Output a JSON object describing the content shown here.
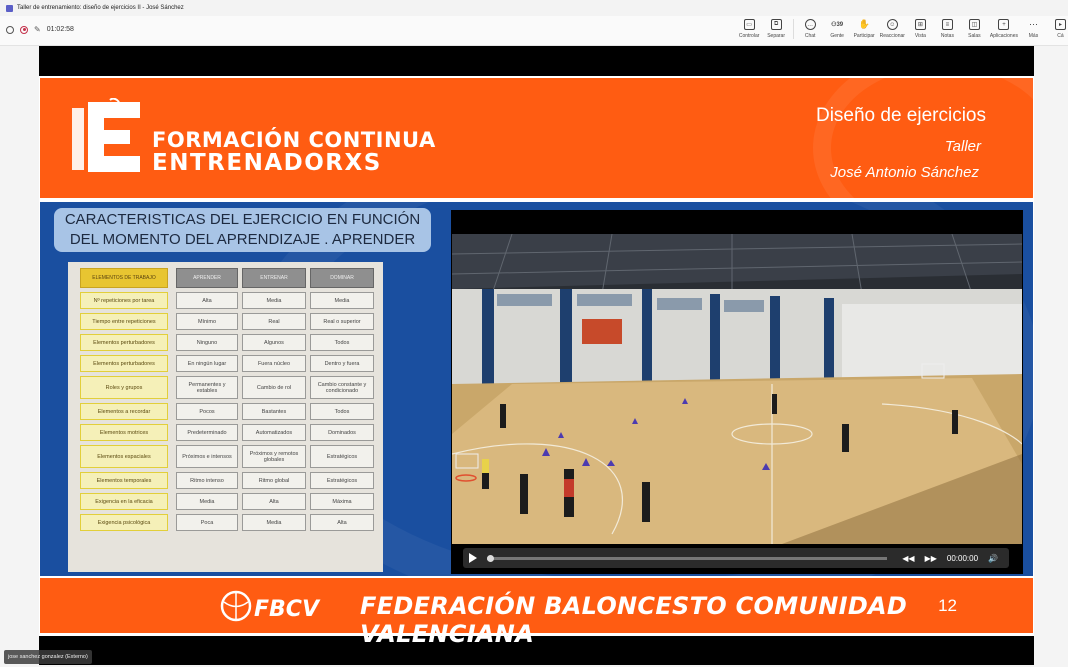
{
  "window": {
    "title": "Taller de entrenamiento: diseño de ejercicios II - José Sánchez"
  },
  "toolbar": {
    "timer": "01:02:58",
    "participants_count": "39",
    "tools": [
      {
        "label": "Controlar",
        "icon": "control-icon"
      },
      {
        "label": "Separar",
        "icon": "popout-icon"
      },
      {
        "label": "Chat",
        "icon": "chat-icon"
      },
      {
        "label": "Gente",
        "icon": "people-icon"
      },
      {
        "label": "Participar",
        "icon": "raise-hand-icon"
      },
      {
        "label": "Reaccionar",
        "icon": "smiley-icon"
      },
      {
        "label": "Vista",
        "icon": "grid-icon"
      },
      {
        "label": "Notas",
        "icon": "notes-icon"
      },
      {
        "label": "Salas",
        "icon": "rooms-icon"
      },
      {
        "label": "Aplicaciones",
        "icon": "add-icon"
      },
      {
        "label": "Más",
        "icon": "more-icon"
      },
      {
        "label": "Cá",
        "icon": "camera-icon"
      }
    ]
  },
  "slide": {
    "banner": {
      "logo_line1": "FORMACIÓN CONTINUA",
      "logo_line2": "ENTRENADORXS",
      "title": "Diseño de ejercicios",
      "subtitle": "Taller",
      "author": "José Antonio Sánchez"
    },
    "caption_line1": "CARACTERISTICAS DEL EJERCICIO EN FUNCIÓN",
    "caption_line2": "DEL MOMENTO DEL APRENDIZAJE . APRENDER",
    "table": {
      "headers": [
        "ELEMENTOS DE TRABAJO",
        "APRENDER",
        "ENTRENAR",
        "DOMINAR"
      ],
      "rows": [
        [
          "Nº repeticiones por tarea",
          "Alta",
          "Media",
          "Media"
        ],
        [
          "Tiempo entre repeticiones",
          "Mínimo",
          "Real",
          "Real o superior"
        ],
        [
          "Elementos perturbadores",
          "Ninguno",
          "Algunos",
          "Todos"
        ],
        [
          "Elementos perturbadores",
          "En ningún lugar",
          "Fuera núcleo",
          "Dentro y fuera"
        ],
        [
          "Roles y grupos",
          "Permanentes y estables",
          "Cambio de rol",
          "Cambio constante y condicionado"
        ],
        [
          "Elementos a recordar",
          "Pocos",
          "Bastantes",
          "Todos"
        ],
        [
          "Elementos motrices",
          "Predeterminado",
          "Automatizados",
          "Dominados"
        ],
        [
          "Elementos espaciales",
          "Próximos e intensos",
          "Próximos y remotos globales",
          "Estratégicos"
        ],
        [
          "Elementos temporales",
          "Ritmo intenso",
          "Ritmo global",
          "Estratégicos"
        ],
        [
          "Exigencia en la eficacia",
          "Media",
          "Alta",
          "Máxima"
        ],
        [
          "Exigencia psicológica",
          "Poca",
          "Media",
          "Alta"
        ]
      ]
    },
    "video": {
      "time": "00:00:00",
      "progress": 0.0
    },
    "footer": {
      "logo_text": "FBCV",
      "text": "FEDERACIÓN BALONCESTO COMUNIDAD VALENCIANA",
      "page": "12"
    }
  },
  "presenter_tag": "jose sanchez gonzalez (Externo)"
}
